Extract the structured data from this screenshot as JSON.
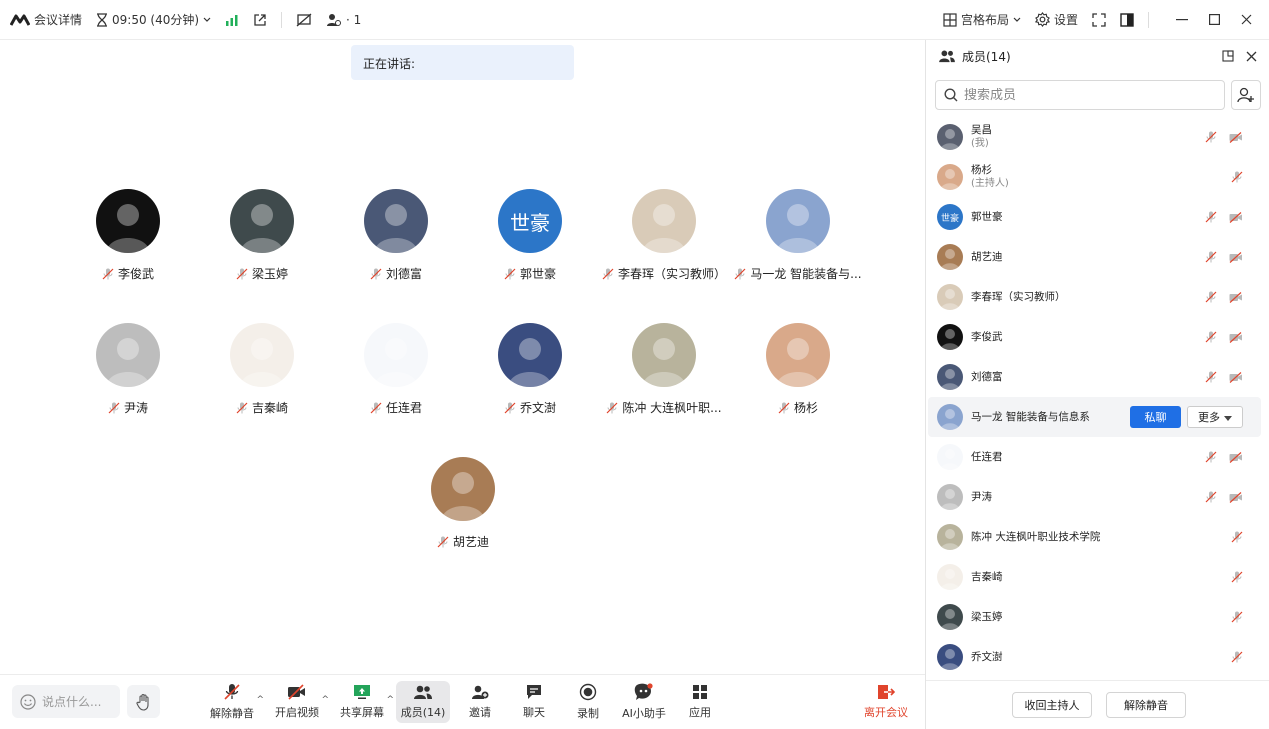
{
  "topbar": {
    "app_title": "会议详情",
    "time": "09:50 (40分钟)",
    "participants_count": "· 1",
    "layout_label": "宫格布局",
    "settings_label": "设置"
  },
  "stage": {
    "speaking_label": "正在讲话:",
    "tiles": [
      {
        "name": "李俊武",
        "avatar_color": "#111111",
        "avatar_text": ""
      },
      {
        "name": "梁玉婷",
        "avatar_color": "#3f4a4c",
        "avatar_text": ""
      },
      {
        "name": "刘德富",
        "avatar_color": "#4a5876",
        "avatar_text": ""
      },
      {
        "name": "郭世豪",
        "avatar_color": "#2c76c8",
        "avatar_text": "世豪"
      },
      {
        "name": "李春珲（实习教师）",
        "avatar_color": "#d9cbb8",
        "avatar_text": ""
      },
      {
        "name": "马一龙 智能装备与...",
        "avatar_color": "#8aa4cf",
        "avatar_text": ""
      },
      {
        "name": "尹涛",
        "avatar_color": "#bdbdbd",
        "avatar_text": ""
      },
      {
        "name": "吉秦崎",
        "avatar_color": "#f4efe9",
        "avatar_text": ""
      },
      {
        "name": "任连君",
        "avatar_color": "#f6f8fb",
        "avatar_text": ""
      },
      {
        "name": "乔文澍",
        "avatar_color": "#3a4d80",
        "avatar_text": ""
      },
      {
        "name": "陈冲  大连枫叶职...",
        "avatar_color": "#b8b39c",
        "avatar_text": ""
      },
      {
        "name": "杨杉",
        "avatar_color": "#d9a98a",
        "avatar_text": ""
      },
      {
        "name": "胡艺迪",
        "avatar_color": "#a87c55",
        "avatar_text": ""
      }
    ]
  },
  "toolbar": {
    "chat_placeholder": "说点什么...",
    "unmute": "解除静音",
    "start_video": "开启视频",
    "share_screen": "共享屏幕",
    "members": "成员(14)",
    "invite": "邀请",
    "chat": "聊天",
    "record": "录制",
    "ai_assistant": "AI小助手",
    "apps": "应用",
    "leave": "离开会议"
  },
  "panel": {
    "title": "成员(14)",
    "search_placeholder": "搜索成员",
    "members": [
      {
        "name": "吴昌",
        "sub": "(我)",
        "avatar_color": "#5a6070",
        "video": true
      },
      {
        "name": "杨杉",
        "sub": "(主持人)",
        "avatar_color": "#d9a98a",
        "video": false
      },
      {
        "name": "郭世豪",
        "sub": "",
        "avatar_color": "#2c76c8",
        "avatar_text": "世豪",
        "video": true
      },
      {
        "name": "胡艺迪",
        "sub": "",
        "avatar_color": "#a87c55",
        "video": true
      },
      {
        "name": "李春珲（实习教师）",
        "sub": "",
        "avatar_color": "#d9cbb8",
        "video": true
      },
      {
        "name": "李俊武",
        "sub": "",
        "avatar_color": "#111111",
        "video": true
      },
      {
        "name": "刘德富",
        "sub": "",
        "avatar_color": "#4a5876",
        "video": true
      },
      {
        "name": "马一龙 智能装备与信息系",
        "sub": "",
        "avatar_color": "#8aa4cf",
        "hover": true
      },
      {
        "name": "任连君",
        "sub": "",
        "avatar_color": "#f6f8fb",
        "video": true
      },
      {
        "name": "尹涛",
        "sub": "",
        "avatar_color": "#bdbdbd",
        "video": true
      },
      {
        "name": "陈冲  大连枫叶职业技术学院",
        "sub": "",
        "avatar_color": "#b8b39c",
        "video": false
      },
      {
        "name": "吉秦崎",
        "sub": "",
        "avatar_color": "#f4efe9",
        "video": false
      },
      {
        "name": "梁玉婷",
        "sub": "",
        "avatar_color": "#3f4a4c",
        "video": false
      },
      {
        "name": "乔文澍",
        "sub": "",
        "avatar_color": "#3a4d80",
        "video": false
      }
    ],
    "private_chat": "私聊",
    "more": "更多",
    "reclaim_host": "收回主持人",
    "unmute_all": "解除静音"
  }
}
